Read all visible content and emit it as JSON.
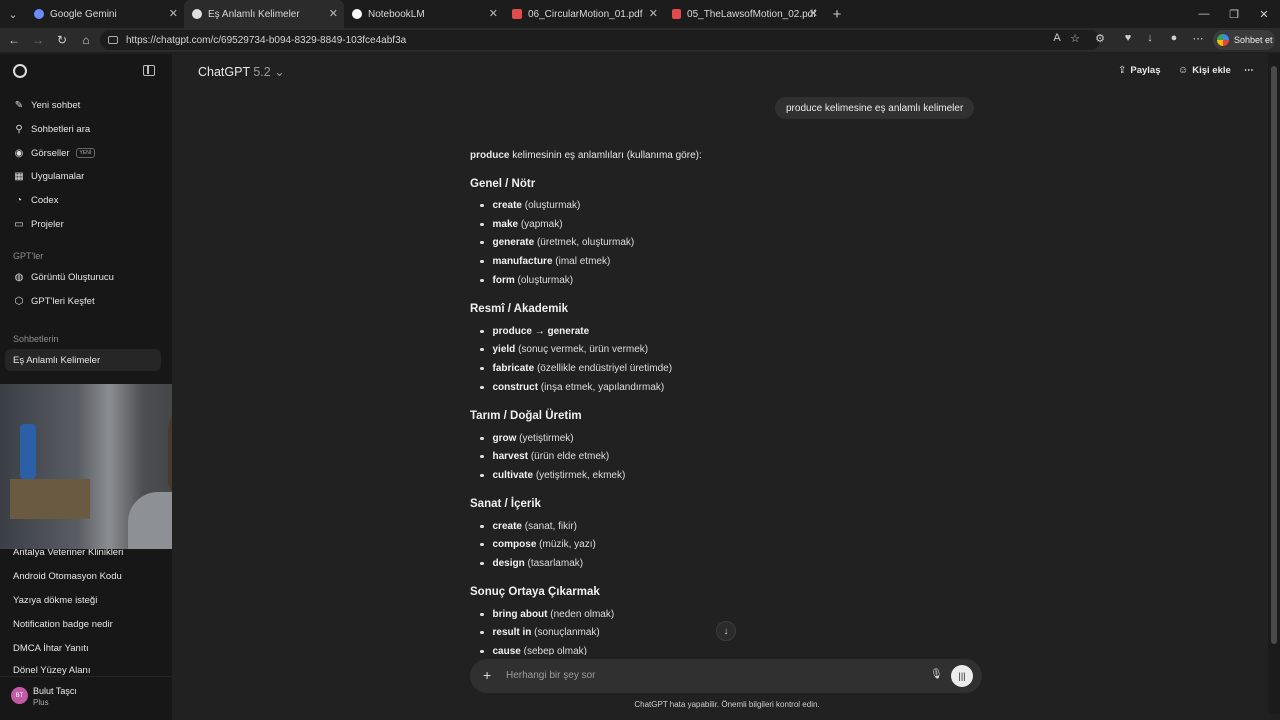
{
  "browser": {
    "tabs": [
      {
        "title": "Google Gemini",
        "icon": "gemini-icon",
        "color": "#6b8cff"
      },
      {
        "title": "Eş Anlamlı Kelimeler",
        "icon": "chatgpt-icon",
        "color": "#e0e0e0"
      },
      {
        "title": "NotebookLM",
        "icon": "notebooklm-icon",
        "color": "#ffffff"
      },
      {
        "title": "06_CircularMotion_01.pdf",
        "icon": "pdf-icon",
        "color": "#e04b4b"
      },
      {
        "title": "05_TheLawsofMotion_02.pdf",
        "icon": "pdf-icon",
        "color": "#e04b4b"
      }
    ],
    "url": "https://chatgpt.com/c/69529734-b094-8329-8849-103fce4abf3a",
    "signin_label": "Sohbet et"
  },
  "sidebar": {
    "items": [
      {
        "label": "Yeni sohbet",
        "icon": "edit-icon"
      },
      {
        "label": "Sohbetleri ara",
        "icon": "search-icon"
      },
      {
        "label": "Görseller",
        "icon": "image-icon",
        "badge": "YENİ"
      },
      {
        "label": "Uygulamalar",
        "icon": "apps-icon"
      },
      {
        "label": "Codex",
        "icon": "codex-icon"
      },
      {
        "label": "Projeler",
        "icon": "folder-icon"
      }
    ],
    "gpts_heading": "GPT'ler",
    "gpts": [
      {
        "label": "Görüntü Oluşturucu",
        "icon": "image-generator-icon"
      },
      {
        "label": "GPT'leri Keşfet",
        "icon": "explore-icon"
      }
    ],
    "chats_heading": "Sohbetlerin",
    "chats": [
      "Eş Anlamlı Kelimeler",
      "Antalya Veteriner Klinikleri",
      "Android Otomasyon Kodu",
      "Yazıya dökme isteği",
      "Notification badge nedir",
      "DMCA İhtar Yanıtı",
      "Dönel Yüzey Alanı"
    ],
    "user": {
      "initials": "BT",
      "name": "Bulut Taşcı",
      "plan": "Plus"
    }
  },
  "header": {
    "model": "ChatGPT",
    "version": "5.2",
    "share_label": "Paylaş",
    "add_person_label": "Kişi ekle"
  },
  "chat": {
    "user_message": "produce kelimesine eş anlamlı kelimeler",
    "intro_bold": "produce",
    "intro_rest": " kelimesinin eş anlamlıları (kullanıma göre):",
    "sections": [
      {
        "title": "Genel / Nötr",
        "items": [
          {
            "word": "create",
            "note": " (oluşturmak)"
          },
          {
            "word": "make",
            "note": " (yapmak)"
          },
          {
            "word": "generate",
            "note": " (üretmek, oluşturmak)"
          },
          {
            "word": "manufacture",
            "note": " (imal etmek)"
          },
          {
            "word": "form",
            "note": " (oluşturmak)"
          }
        ]
      },
      {
        "title": "Resmî / Akademik",
        "items": [
          {
            "word": "produce → generate",
            "note": ""
          },
          {
            "word": "yield",
            "note": " (sonuç vermek, ürün vermek)"
          },
          {
            "word": "fabricate",
            "note": " (özellikle endüstriyel üretimde)"
          },
          {
            "word": "construct",
            "note": " (inşa etmek, yapılandırmak)"
          }
        ]
      },
      {
        "title": "Tarım / Doğal Üretim",
        "items": [
          {
            "word": "grow",
            "note": " (yetiştirmek)"
          },
          {
            "word": "harvest",
            "note": " (ürün elde etmek)"
          },
          {
            "word": "cultivate",
            "note": " (yetiştirmek, ekmek)"
          }
        ]
      },
      {
        "title": "Sanat / İçerik",
        "items": [
          {
            "word": "create",
            "note": " (sanat, fikir)"
          },
          {
            "word": "compose",
            "note": " (müzik, yazı)"
          },
          {
            "word": "design",
            "note": " (tasarlamak)"
          }
        ]
      },
      {
        "title": "Sonuç Ortaya Çıkarmak",
        "items": [
          {
            "word": "bring about",
            "note": " (neden olmak)"
          },
          {
            "word": "result in",
            "note": " (sonuçlanmak)"
          },
          {
            "word": "cause",
            "note": " (sebep olmak)"
          }
        ]
      }
    ]
  },
  "composer": {
    "placeholder": "Herhangi bir şey sor"
  },
  "disclaimer": "ChatGPT hata yapabilir. Önemli bilgileri kontrol edin."
}
